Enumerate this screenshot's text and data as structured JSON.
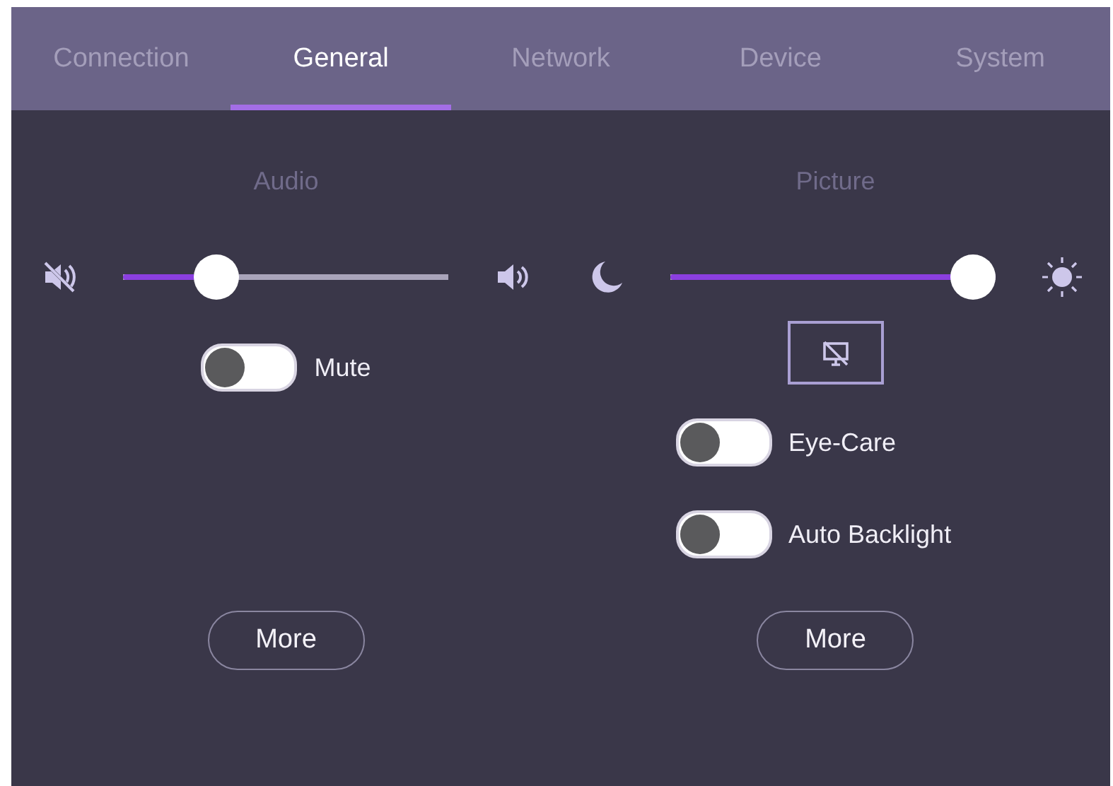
{
  "tabs": [
    {
      "label": "Connection",
      "selected": false
    },
    {
      "label": "General",
      "selected": true
    },
    {
      "label": "Network",
      "selected": false
    },
    {
      "label": "Device",
      "selected": false
    },
    {
      "label": "System",
      "selected": false
    }
  ],
  "sections": [
    {
      "heading": "Audio",
      "items": [
        {
          "kind": "volume_slider",
          "level": 0.25
        },
        {
          "kind": "toggle",
          "label": "Mute",
          "on": false
        },
        {
          "kind": "button",
          "label": "More"
        }
      ]
    },
    {
      "heading": "Picture",
      "items": [
        {
          "kind": "brightness_slider",
          "level": 1.0
        },
        {
          "kind": "screen_off_button"
        },
        {
          "kind": "toggle",
          "label": "Eye-Care",
          "on": false
        },
        {
          "kind": "toggle",
          "label": "Auto Backlight",
          "on": false
        },
        {
          "kind": "button",
          "label": "More"
        }
      ]
    }
  ]
}
